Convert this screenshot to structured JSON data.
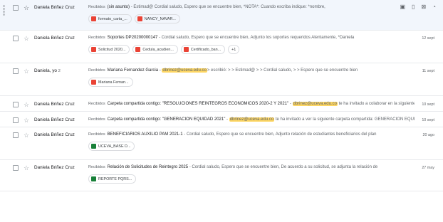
{
  "emails": [
    {
      "sender": "Daniela Briñez Cruz",
      "tag": "Recibidos",
      "subject": "(sin asunto)",
      "snippet_before": " - Estimad@ Cordial saludo, Espero que se encuentre bien, *NOTA*: Cuando escriba indique: *nombre,",
      "highlight": "",
      "snippet_after": "",
      "date": "",
      "attachments": [
        {
          "name": "formato_carta_...",
          "type": "pdf"
        },
        {
          "name": "NANCY_NAVAR...",
          "type": "pdf"
        }
      ],
      "more": ""
    },
    {
      "sender": "Daniela Briñez Cruz",
      "tag": "Recibidos",
      "subject": "Soportes DP20200000147",
      "snippet_before": " - Cordial saludo, Espero que se encuentre bien, Adjunto los soportes requeridos Atentamente, *Daniela",
      "highlight": "",
      "snippet_after": "",
      "date": "12 sept",
      "attachments": [
        {
          "name": "Solicitud 2020...",
          "type": "pdf"
        },
        {
          "name": "Cedula_acudien...",
          "type": "pdf"
        },
        {
          "name": "Certificado_ban...",
          "type": "pdf"
        }
      ],
      "more": "+1"
    },
    {
      "sender": "Daniela, yo",
      "count": "2",
      "tag": "Recibidos",
      "subject": "Mariana Fernandez Garcia - ",
      "snippet_before": "",
      "highlight": "dbrinez@uceva.edu.co",
      "snippet_after": "> escribió: > > Estimad@ > > Cordial saludo, > > Espero que se encuentre bien",
      "date": "11 sept",
      "attachments": [
        {
          "name": "Mariana Fernan...",
          "type": "pdf"
        }
      ],
      "more": ""
    },
    {
      "sender": "Daniela Briñez Cruz",
      "tag": "Recibidos",
      "subject": "Carpeta compartida contigo: \"RESOLUCIONES REINTEGROS ECONOMICOS 2020-2 Y 2021\"",
      "snippet_before": " - ",
      "highlight": "dbrinez@uceva.edu.co",
      "snippet_after": " te ha invitado a colaborar en la siguiente carpeta co...",
      "date": "10 sept",
      "attachments": [],
      "more": ""
    },
    {
      "sender": "Daniela Briñez Cruz",
      "tag": "Recibidos",
      "subject": "Carpeta compartida contigo: \"GENERACIÓN EQUIDAD 2021\"",
      "snippet_before": " - ",
      "highlight": "dbrinez@uceva.edu.co",
      "snippet_after": " te ha invitado a ver la siguiente carpeta compartida: GENERACIÓN EQUIDAD 2021 ...",
      "date": "10 sept",
      "attachments": [],
      "more": ""
    },
    {
      "sender": "Daniela Briñez Cruz",
      "tag": "Recibidos",
      "subject": "BENEFICIARIOS AUXILIO PAM 2021-1",
      "snippet_before": " - Cordial saludo, Espero que se encuentre bien, Adjunto relación de estudiantes beneficiarios del plan",
      "highlight": "",
      "snippet_after": "",
      "date": "20 ago",
      "attachments": [
        {
          "name": "UCEVA_BASE D...",
          "type": "sheet"
        }
      ],
      "more": ""
    },
    {
      "sender": "Daniela Briñez Cruz",
      "tag": "Recibidos",
      "subject": "Relación de Solicitudes de Reintegro 2025",
      "snippet_before": " - Cordial saludo, Espero que se encuentre bien, De acuerdo a su solicitud, se adjunta la relación de",
      "highlight": "",
      "snippet_after": "",
      "date": "27 may",
      "attachments": [
        {
          "name": "REPORTE PQRS...",
          "type": "sheet"
        }
      ],
      "more": ""
    }
  ],
  "row_actions": [
    "archive-icon",
    "delete-icon",
    "mark-unread-icon",
    "snooze-icon"
  ],
  "colors": {
    "pdf": "#ea4335",
    "sheet": "#188038",
    "highlight": "#fdd663",
    "hover_row": "#f2f6fc"
  }
}
